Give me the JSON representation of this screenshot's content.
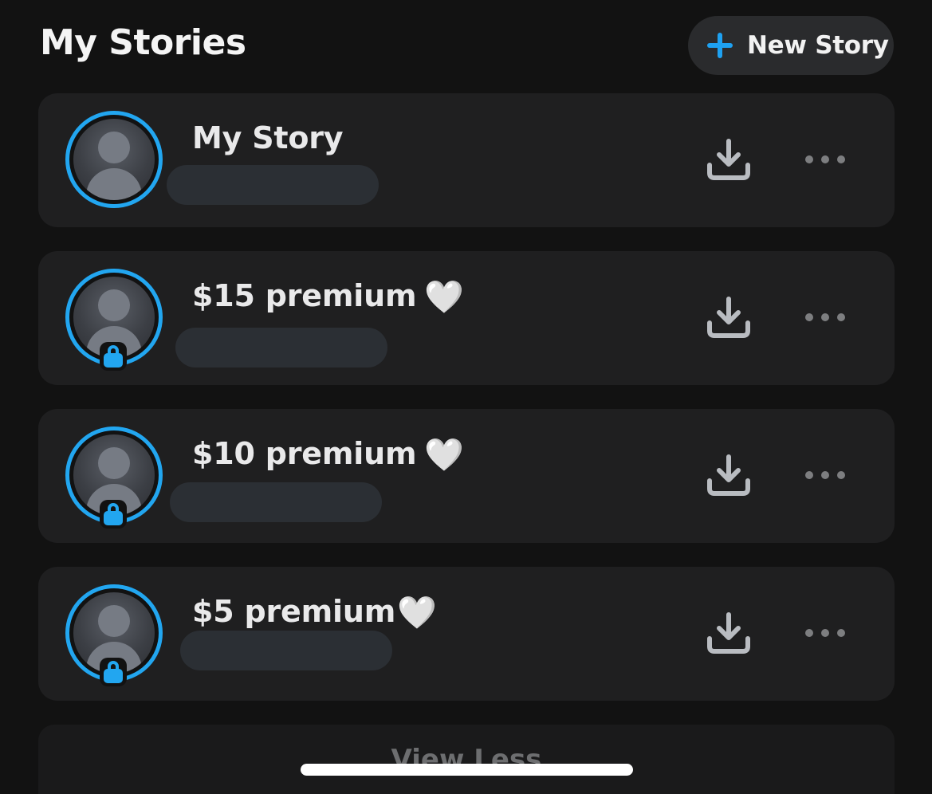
{
  "header": {
    "title": "My Stories",
    "new_story_label": "New Story",
    "new_story_icon": "plus-icon"
  },
  "colors": {
    "accent": "#22a6f0",
    "background": "#121212",
    "card": "#1f1f20"
  },
  "stories": [
    {
      "title": "My Story",
      "locked": false,
      "heart": "",
      "subtitle": ""
    },
    {
      "title": "$15 premium",
      "locked": true,
      "heart": "🤍",
      "subtitle": ""
    },
    {
      "title": "$10 premium",
      "locked": true,
      "heart": "🤍",
      "subtitle": ""
    },
    {
      "title": "$5 premium",
      "locked": true,
      "heart": "🤍",
      "subtitle": ""
    }
  ],
  "footer": {
    "view_less_label": "View Less"
  }
}
